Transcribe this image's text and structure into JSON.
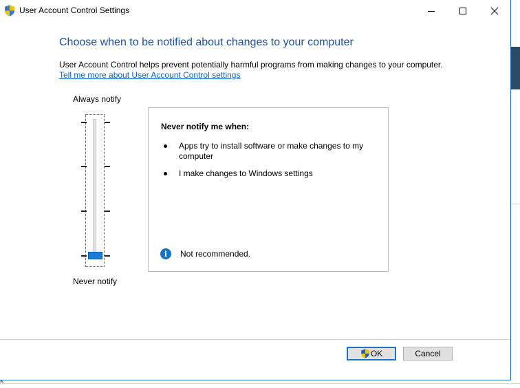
{
  "window": {
    "title": "User Account Control Settings",
    "controls": {
      "minimize": "minimize-icon",
      "maximize": "maximize-icon",
      "close": "close-icon"
    }
  },
  "main": {
    "heading": "Choose when to be notified about changes to your computer",
    "description": "User Account Control helps prevent potentially harmful programs from making changes to your computer.",
    "learn_more_link": "Tell me more about User Account Control settings"
  },
  "slider": {
    "top_label": "Always notify",
    "bottom_label": "Never notify",
    "levels": 4,
    "selected_level": 1
  },
  "panel": {
    "title": "Never notify me when:",
    "bullets": [
      "Apps try to install software or make changes to my computer",
      "I make changes to Windows settings"
    ],
    "note_icon": "info-icon",
    "note": "Not recommended."
  },
  "buttons": {
    "ok": "OK",
    "cancel": "Cancel"
  },
  "colors": {
    "heading": "#1e4fa0",
    "link": "#0b62c9",
    "accent": "#1a73c7",
    "slider_thumb": "#1a7ad8"
  },
  "background": {
    "partial_text": "k"
  }
}
